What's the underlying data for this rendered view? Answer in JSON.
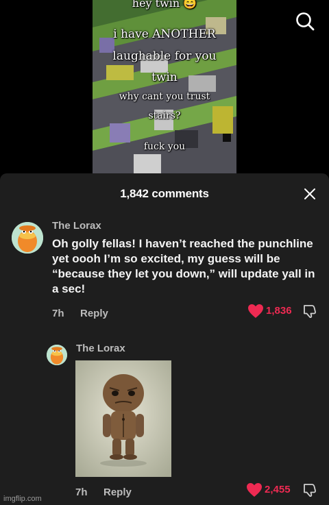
{
  "video": {
    "captions": [
      "hey twin 😄",
      "i have ANOTHER",
      "laughable for you",
      "twin",
      "why cant you trust",
      "stairs?",
      "fuck you"
    ]
  },
  "top_bar": {
    "search_icon": "search-icon"
  },
  "comments_panel": {
    "title": "1,842 comments",
    "close_icon": "close-icon",
    "comments": [
      {
        "username": "The Lorax",
        "text": "Oh golly fellas! I haven’t reached the punchline yet oooh I’m so excited, my guess will be “because they let you down,” will update yall in a sec!",
        "time": "7h",
        "reply_label": "Reply",
        "likes": "1,836",
        "like_color": "#ee2a52"
      },
      {
        "username": "The Lorax",
        "image": "knitted-doll-photo",
        "time": "7h",
        "reply_label": "Reply",
        "likes": "2,455",
        "like_color": "#ee2a52"
      }
    ]
  },
  "watermark": "imgflip.com"
}
